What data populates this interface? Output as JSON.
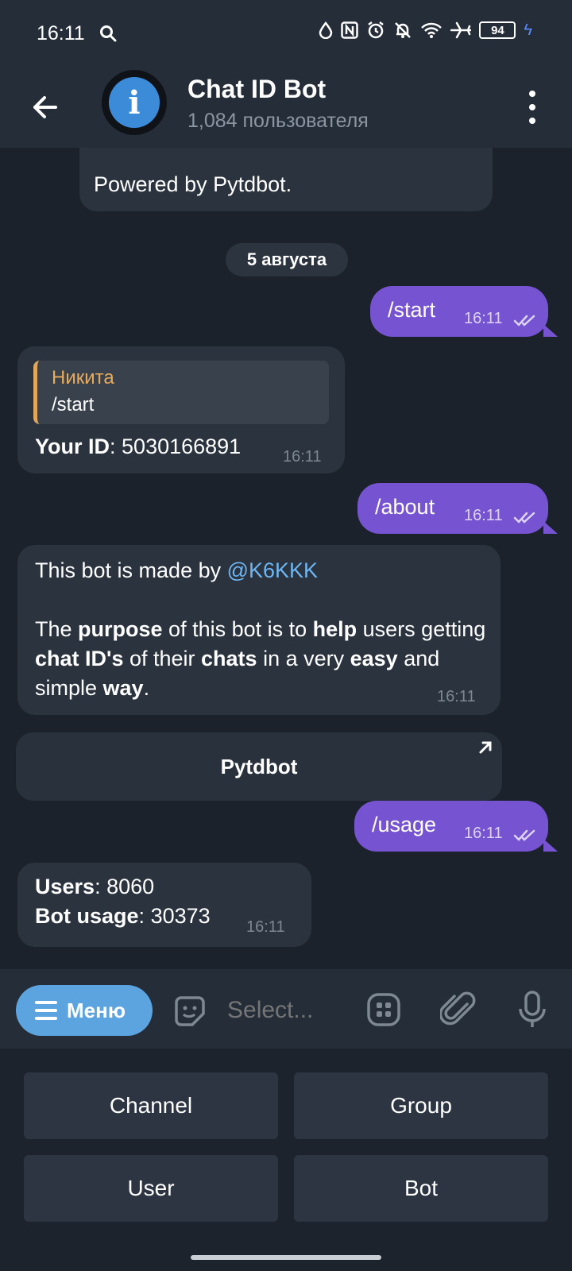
{
  "status_bar": {
    "time": "16:11",
    "battery": "94",
    "icons": [
      "search-icon",
      "water-drop-icon",
      "nfc-icon",
      "alarm-icon",
      "bell-off-icon",
      "wifi-icon",
      "airplane-icon",
      "battery-icon",
      "charging-icon"
    ]
  },
  "header": {
    "title": "Chat ID Bot",
    "subtitle": "1,084 пользователя",
    "avatar_glyph": "i"
  },
  "messages": {
    "prev_tail": "Powered by Pytdbot.",
    "date_separator": "5 августа",
    "m1": {
      "text": "/start",
      "time": "16:11"
    },
    "m2": {
      "reply_name": "Никита",
      "reply_text": "/start",
      "label": "Your ID",
      "sep": ":",
      "value": "5030166891",
      "time": "16:11"
    },
    "m3": {
      "text": "/about",
      "time": "16:11"
    },
    "m4": {
      "line1_prefix": "This bot is made by ",
      "mention": "@K6KKK",
      "p2": [
        "The ",
        "purpose",
        " of this bot is to ",
        "help",
        " users getting ",
        "chat ID's",
        " of their ",
        "chats",
        " in a very ",
        "easy",
        " and simple ",
        "way",
        "."
      ],
      "time": "16:11",
      "button": "Pytdbot"
    },
    "m5": {
      "text": "/usage",
      "time": "16:11"
    },
    "m6": {
      "users_label": "Users",
      "users_value": "8060",
      "usage_label": "Bot usage",
      "usage_value": "30373",
      "sep": ":",
      "time": "16:11"
    }
  },
  "composer": {
    "menu_label": "Меню",
    "placeholder": "Select..."
  },
  "keyboard": {
    "buttons": [
      "Channel",
      "Group",
      "User",
      "Bot"
    ]
  },
  "colors": {
    "outgoing_bubble": "#7653d0",
    "incoming_bubble": "#2a333e",
    "menu_button": "#5ca4e0",
    "mention": "#6eb6f2",
    "reply_accent": "#e2a75a"
  }
}
